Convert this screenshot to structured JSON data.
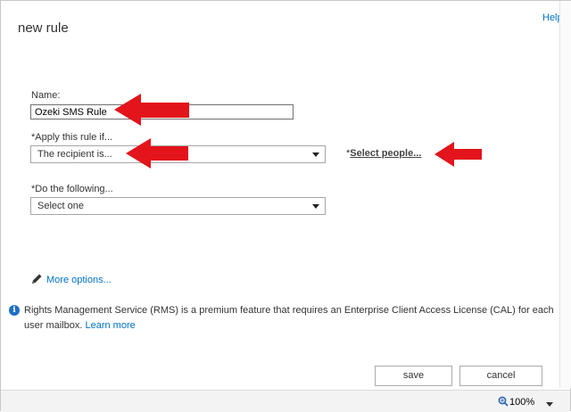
{
  "dialog": {
    "title": "new rule",
    "help_label": "Help"
  },
  "form": {
    "name_label": "Name:",
    "name_value": "Ozeki SMS Rule",
    "apply_label": "*Apply this rule if...",
    "apply_value": "The recipient is...",
    "select_people_prefix": "*",
    "select_people_link": "Select people...",
    "do_label": "*Do the following...",
    "do_value": "Select one",
    "more_options": "More options..."
  },
  "info": {
    "text": "Rights Management Service (RMS) is a premium feature that requires an Enterprise Client Access License (CAL) for each user mailbox. ",
    "learn_more": "Learn more"
  },
  "buttons": {
    "save": "save",
    "cancel": "cancel"
  },
  "status": {
    "zoom": "100%"
  },
  "colors": {
    "link": "#0072c6",
    "annotation_arrow": "#e3141b",
    "info_icon": "#1e6fc4"
  }
}
